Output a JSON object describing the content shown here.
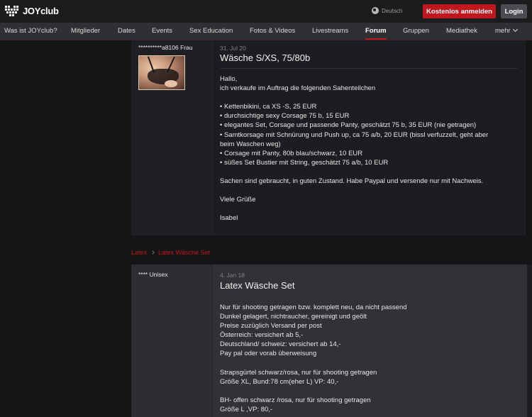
{
  "header": {
    "logo_text": "JOYclub",
    "language": "Deutsch",
    "register_label": "Kostenlos anmelden",
    "login_label": "Login"
  },
  "nav": {
    "items": [
      {
        "label": "Was ist JOYclub?"
      },
      {
        "label": "Mitglieder"
      },
      {
        "label": "Dates"
      },
      {
        "label": "Events"
      },
      {
        "label": "Sex Education"
      },
      {
        "label": "Fotos & Videos"
      },
      {
        "label": "Livestreams"
      },
      {
        "label": "Forum",
        "active": true
      },
      {
        "label": "Gruppen"
      },
      {
        "label": "Mediathek"
      },
      {
        "label": "mehr"
      }
    ]
  },
  "posts": [
    {
      "author": "**********a8106 Frau",
      "date": "31. Jul 20",
      "title": "Wäsche S/XS, 75/80b",
      "lines": [
        "Hallo,",
        "ich verkaufe im Auftrag die folgenden Sahenteilchen",
        "",
        "• Kettenbikini, ca XS -S, 25 EUR",
        "• durchsichtige sexy Corsage 75 b, 15 EUR",
        "• elegantes Set, Corsage und passende Panty, geschätzt 75 b, 35 EUR (nie getragen)",
        "• Samtkorsage mit Schnürung und Push up, ca 75 a/b, 20 EUR (bissl verfuzzelt, geht aber",
        "beim Waschen weg)",
        "• Corsage mit Panty, 80b blau/schwarz, 10 EUR",
        "• süßes Set Bustier mit String, geschätzt 75 a/b, 10 EUR",
        "",
        "Sachen sind gebraucht, in guten Zustand. Habe Paypal und versende nur mit Nachweis.",
        "",
        "Viele Grüße",
        "",
        "Isabel"
      ]
    },
    {
      "breadcrumb": [
        "Latex",
        "Latex Wäsche Set"
      ],
      "author": "**** Unisex",
      "date": "4. Jan 18",
      "title": "Latex Wäsche Set",
      "lines": [
        "Nur für shooting getragen bzw. komplett neu, da nicht passend",
        "Dunkel gelagert, nichtraucher, gereinigt und geölt",
        "Preise zuzüglich Versand per post",
        "Österreich: versichert ab 5,-",
        "Deutschland/ schweiz: versichert ab 14,-",
        "Pay pal oder vorab überweisung",
        "",
        "Strapsgürtel schwarz/rosa, nur für shooting getragen",
        "Größe XL, Bund:78 cm(eher L) VP: 40,-",
        "",
        "BH- offen schwarz /rosa, nur für shooting getragen",
        "Größe L ,VP: 80,-"
      ]
    }
  ]
}
